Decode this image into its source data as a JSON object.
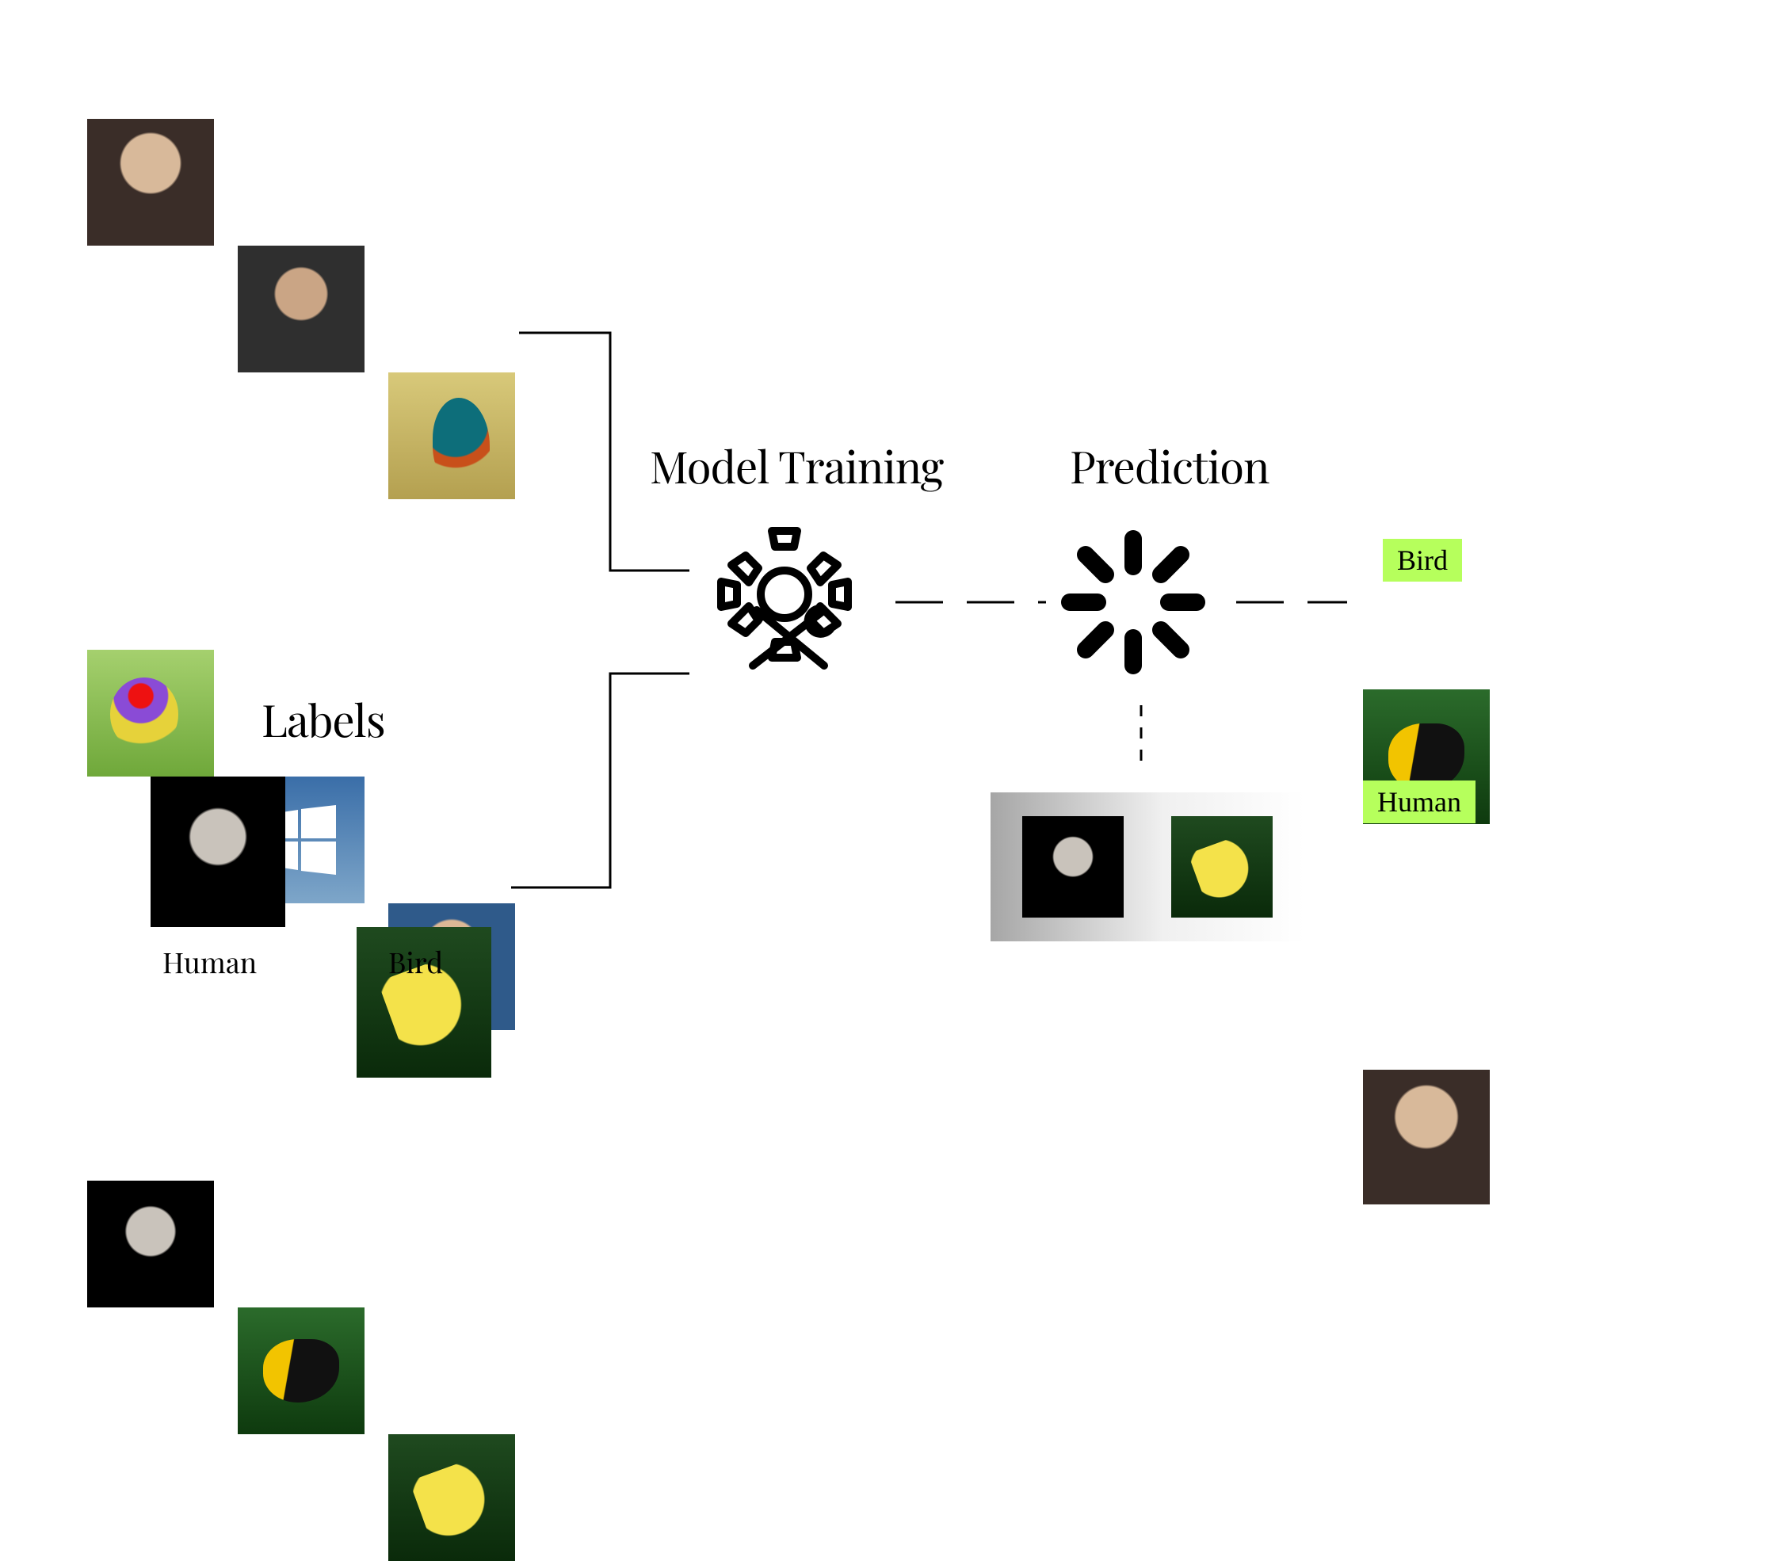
{
  "diagram": {
    "stage_training_label": "Model Training",
    "stage_prediction_label": "Prediction",
    "labels_heading": "Labels",
    "label_examples": [
      {
        "name": "Human"
      },
      {
        "name": "Bird"
      }
    ],
    "training_grid": [
      [
        "human-portrait",
        "human-beard-portrait",
        "kingfisher-bird"
      ],
      [
        "gouldian-finch-bird",
        "windows-logo",
        "human-portrait-denim"
      ],
      [
        "human-dark-portrait",
        "toucan-bird",
        "yellow-bird-flying"
      ]
    ],
    "prediction_outputs": [
      {
        "image": "toucan-bird",
        "class": "Bird"
      },
      {
        "image": "human-portrait",
        "class": "Human"
      }
    ],
    "prediction_inputs": [
      "human-dark-portrait",
      "yellow-bird-flying"
    ]
  },
  "icons": {
    "training": "gear-with-wrench-pencil",
    "prediction": "loading-spinner"
  }
}
